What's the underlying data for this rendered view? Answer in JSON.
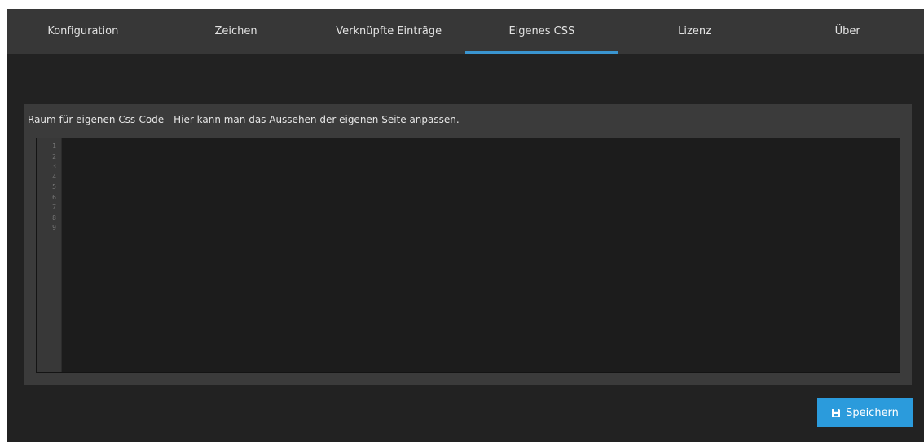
{
  "tabs": [
    {
      "label": "Konfiguration",
      "active": false
    },
    {
      "label": "Zeichen",
      "active": false
    },
    {
      "label": "Verknüpfte Einträge",
      "active": false
    },
    {
      "label": "Eigenes CSS",
      "active": true
    },
    {
      "label": "Lizenz",
      "active": false
    },
    {
      "label": "Über",
      "active": false
    }
  ],
  "panel": {
    "description": "Raum für eigenen Css-Code - Hier kann man das Aussehen der eigenen Seite anpassen.",
    "editor": {
      "line_numbers": [
        "1",
        "2",
        "3",
        "4",
        "5",
        "6",
        "7",
        "8",
        "9"
      ],
      "content": ""
    }
  },
  "save_button": {
    "label": "Speichern",
    "icon": "floppy-disk-icon"
  },
  "colors": {
    "accent": "#3a95d0",
    "button": "#2b9bdc",
    "background": "#222222",
    "tabbar": "#373737"
  }
}
